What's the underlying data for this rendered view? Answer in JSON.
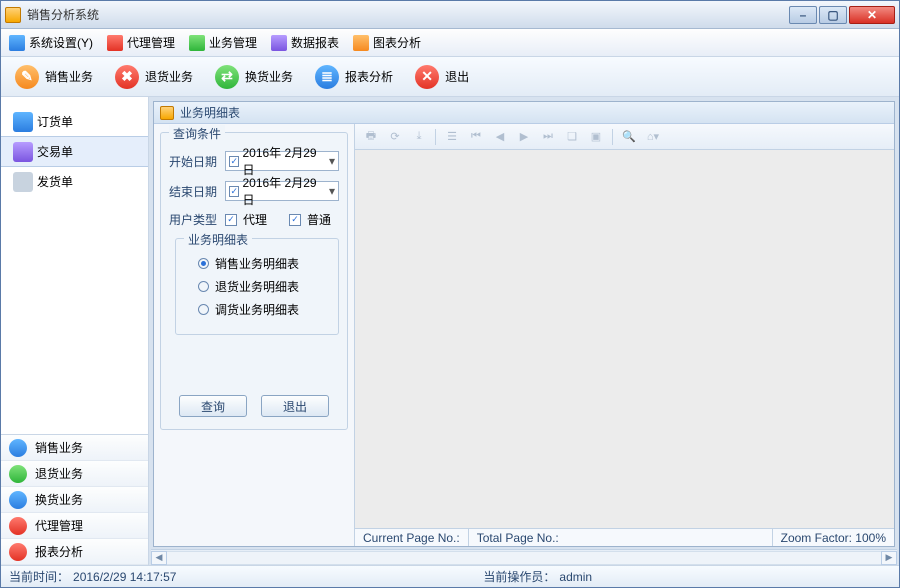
{
  "window": {
    "title": "销售分析系统"
  },
  "menu": {
    "system": "系统设置(Y)",
    "agent": "代理管理",
    "business": "业务管理",
    "data_report": "数据报表",
    "chart": "图表分析"
  },
  "toolbar": {
    "sales": "销售业务",
    "returns": "退货业务",
    "exchange": "换货业务",
    "report": "报表分析",
    "exit": "退出"
  },
  "sidebar": {
    "top": [
      {
        "label": "订货单",
        "name": "order-form",
        "selected": false
      },
      {
        "label": "交易单",
        "name": "transaction-form",
        "selected": true
      },
      {
        "label": "发货单",
        "name": "shipping-form",
        "selected": false
      }
    ],
    "stack": [
      {
        "label": "销售业务",
        "name": "sales"
      },
      {
        "label": "退货业务",
        "name": "returns"
      },
      {
        "label": "换货业务",
        "name": "exchange"
      },
      {
        "label": "代理管理",
        "name": "agent-mgmt"
      },
      {
        "label": "报表分析",
        "name": "report-analysis"
      }
    ]
  },
  "child": {
    "title": "业务明细表",
    "query": {
      "legend": "查询条件",
      "start_label": "开始日期",
      "start_value": "2016年  2月29日",
      "end_label": "结束日期",
      "end_value": "2016年  2月29日",
      "user_type_label": "用户类型",
      "agent_label": "代理",
      "normal_label": "普通",
      "detail_legend": "业务明细表",
      "radios": [
        {
          "label": "销售业务明细表",
          "checked": true
        },
        {
          "label": "退货业务明细表",
          "checked": false
        },
        {
          "label": "调货业务明细表",
          "checked": false
        }
      ],
      "query_btn": "查询",
      "exit_btn": "退出"
    },
    "report_status": {
      "current_page": "Current Page No.:",
      "total_page": "Total Page No.:",
      "zoom": "Zoom Factor: 100%"
    }
  },
  "statusbar": {
    "time_label": "当前时间：",
    "time_value": "2016/2/29 14:17:57",
    "operator_label": "当前操作员：",
    "operator_value": "admin"
  }
}
